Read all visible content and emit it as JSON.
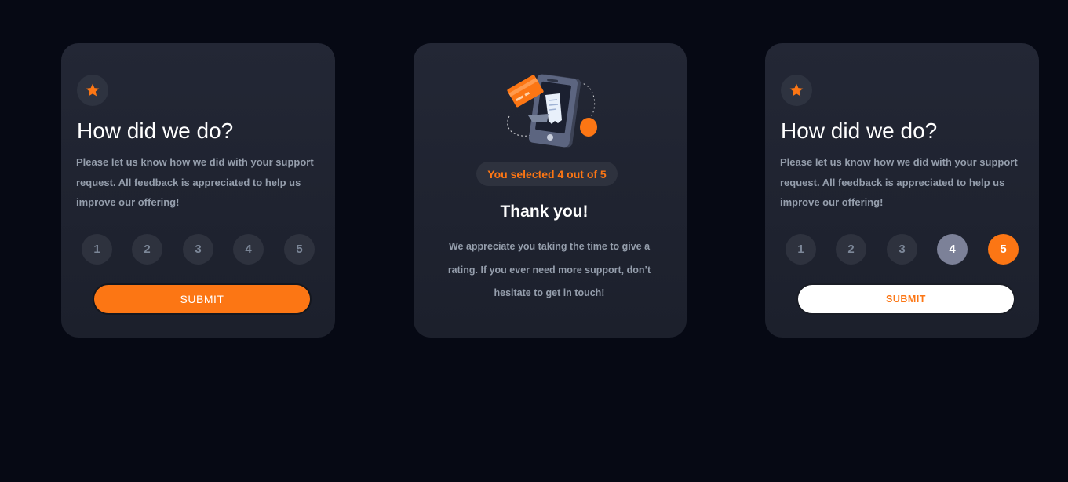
{
  "colors": {
    "page_background": "#060914",
    "card_background": "#232735",
    "accent_orange": "#fc7614",
    "muted_grey": "#959eac",
    "selected_grey": "#7c8198"
  },
  "rating_card_default": {
    "icon": "star-icon",
    "title": "How did we do?",
    "description": "Please let us know how we did with your support request. All feedback is appreciated to help us improve our offering!",
    "ratings": [
      "1",
      "2",
      "3",
      "4",
      "5"
    ],
    "selected_rating": null,
    "submit_label": "SUBMIT"
  },
  "thank_you_card": {
    "illustration": "phone-payment-illustration",
    "selected_text": "You selected 4 out of 5",
    "title": "Thank you!",
    "description": "We appreciate you taking the time to give a rating. If you ever need more support, don’t hesitate to get in touch!"
  },
  "rating_card_active": {
    "icon": "star-icon",
    "title": "How did we do?",
    "description": "Please let us know how we did with your support request. All feedback is appreciated to help us improve our offering!",
    "ratings": [
      "1",
      "2",
      "3",
      "4",
      "5"
    ],
    "hover_rating": "4",
    "selected_rating": "5",
    "submit_label": "SUBMIT"
  }
}
